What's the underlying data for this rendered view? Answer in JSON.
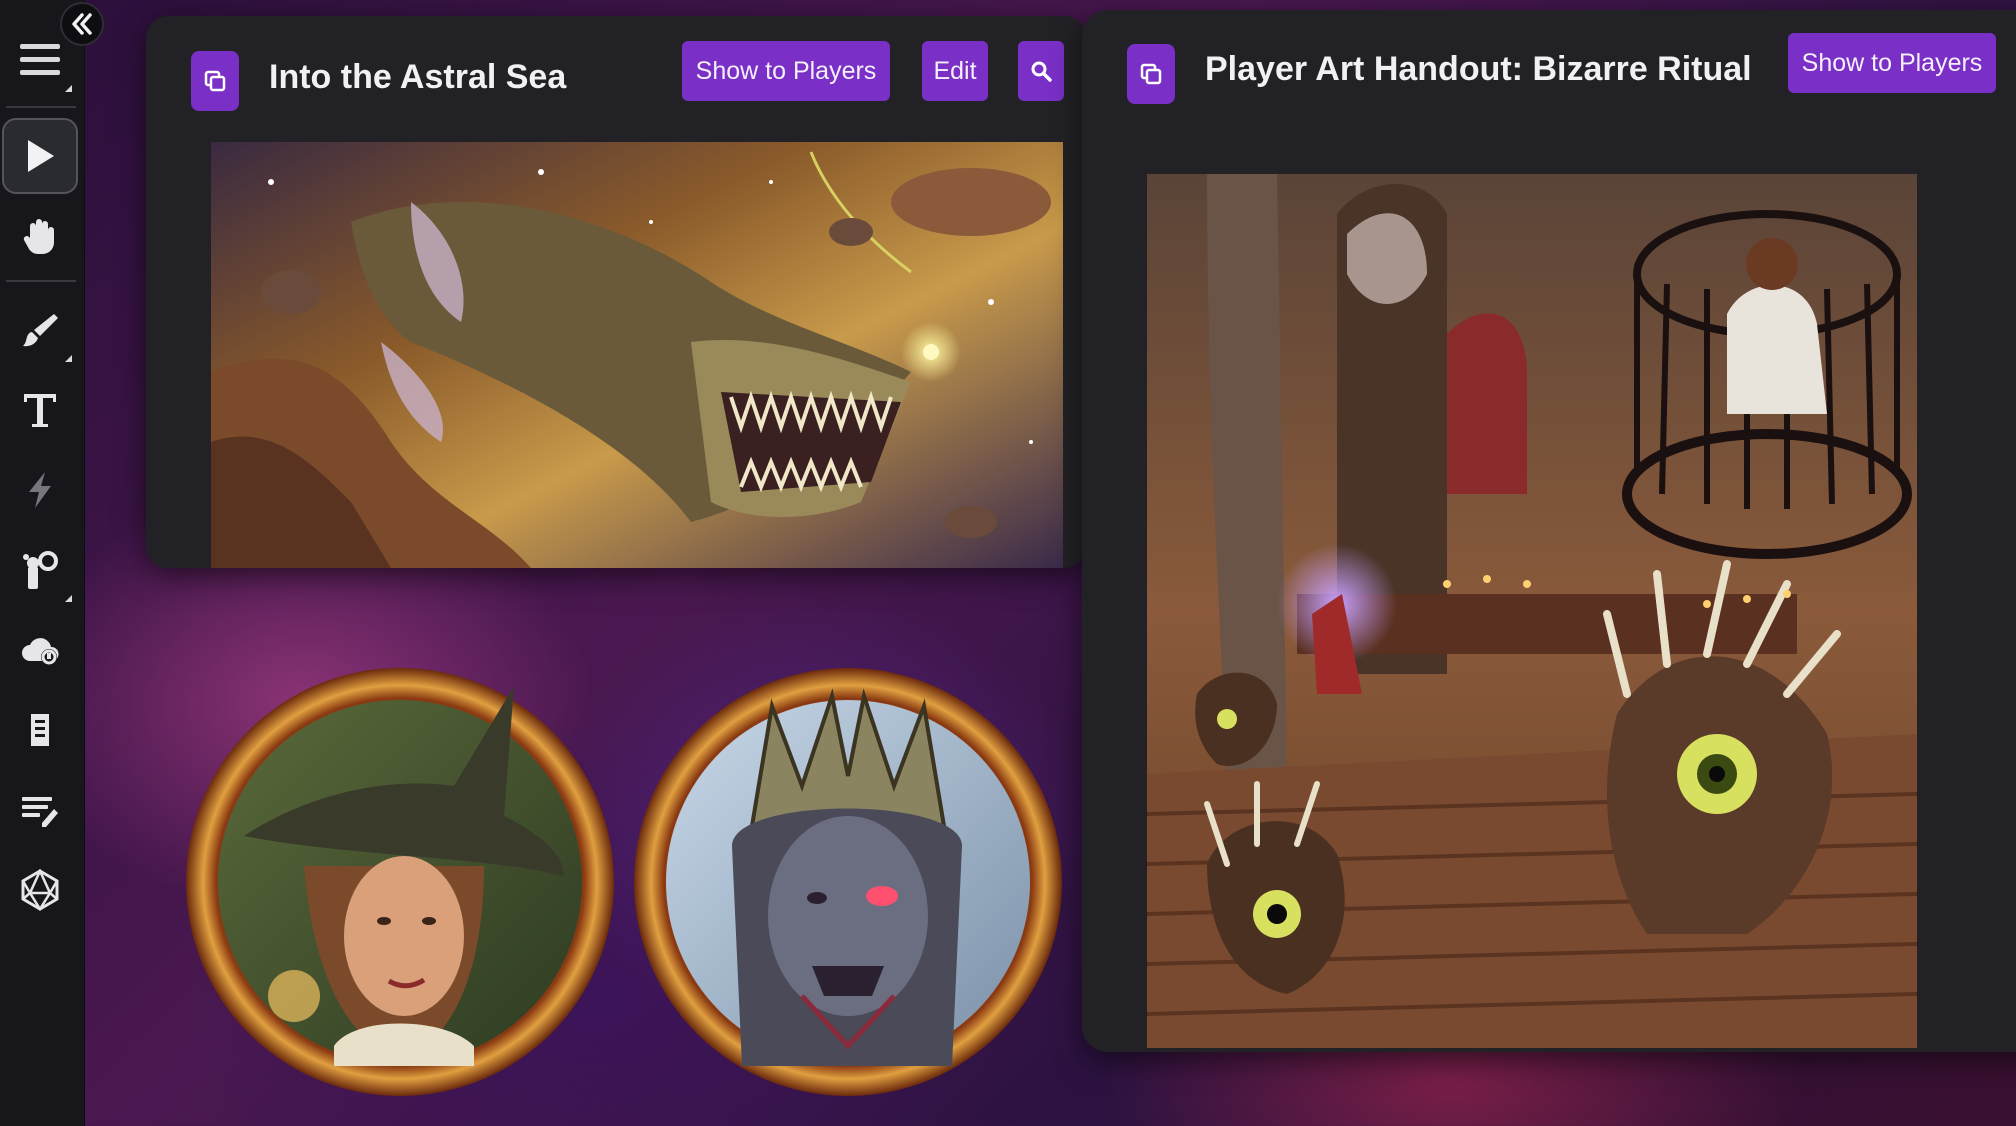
{
  "colors": {
    "accent": "#7a2fc6",
    "panel_bg": "#222226",
    "toolbar_bg": "#17161b"
  },
  "toolbar": {
    "collapse_icon": "double-chevron-left-icon",
    "tools": [
      {
        "name": "menu-icon"
      },
      {
        "name": "pointer-icon",
        "active": true
      },
      {
        "name": "hand-icon"
      },
      {
        "name": "brush-icon"
      },
      {
        "name": "text-icon"
      },
      {
        "name": "lightning-icon"
      },
      {
        "name": "fog-tool-icon"
      },
      {
        "name": "cloud-weather-icon"
      },
      {
        "name": "book-icon"
      },
      {
        "name": "notes-icon"
      },
      {
        "name": "d20-icon"
      }
    ]
  },
  "panels": {
    "astral": {
      "title": "Into the Astral Sea",
      "show_label": "Show to Players",
      "edit_label": "Edit",
      "search_icon": "search-icon",
      "popout_icon": "popout-icon"
    },
    "ritual": {
      "title": "Player Art Handout: Bizarre Ritual",
      "show_label": "Show to Players",
      "popout_icon": "popout-icon"
    }
  },
  "tokens": [
    {
      "name": "witch-token"
    },
    {
      "name": "lich-token"
    }
  ]
}
